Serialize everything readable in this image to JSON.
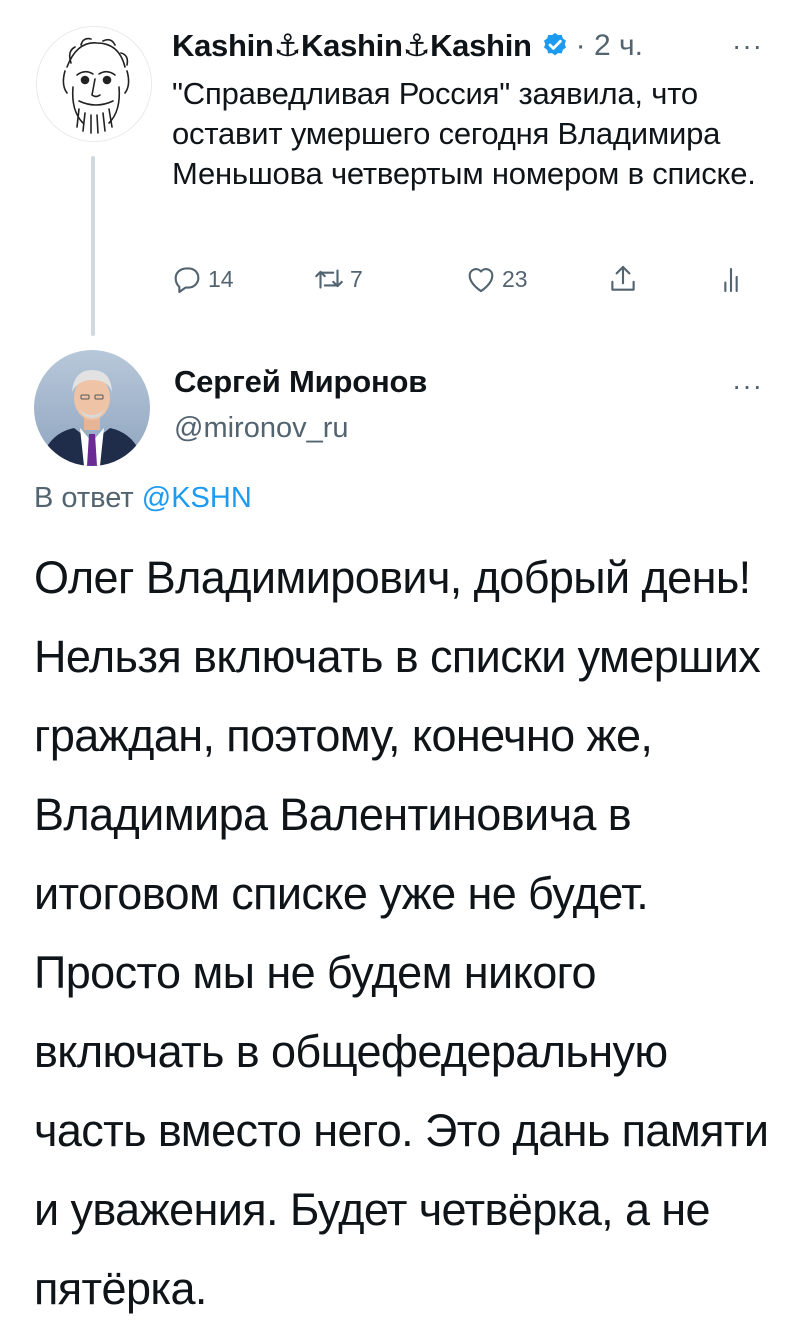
{
  "tweet1": {
    "display_name": "Kashin⚓Kashin⚓Kashin",
    "time": "· 2 ч.",
    "more": "···",
    "text": "\"Справедливая Россия\" заявила, что оставит умершего сегодня Владимира Меньшова четвертым номером в списке.",
    "actions": {
      "reply_count": "14",
      "retweet_count": "7",
      "like_count": "23"
    }
  },
  "tweet2": {
    "display_name": "Сергей Миронов",
    "handle": "@mironov_ru",
    "more": "···",
    "reply_prefix": "В ответ",
    "reply_to": "@KSHN",
    "text": "Олег Владимирович, добрый день! Нельзя включать в списки умерших граждан, поэтому, конечно же, Владимира Валентиновича в итоговом списке уже не будет. Просто мы не будем никого включать в общефедеральную часть вместо него. Это дань памяти и уважения. Будет четвёрка, а не пятёрка."
  },
  "colors": {
    "accent": "#1d9bf0",
    "muted": "#536471",
    "text": "#0f1419",
    "thread_line": "#cfd9de"
  },
  "icons": [
    "reply-icon",
    "retweet-icon",
    "like-icon",
    "share-icon",
    "analytics-icon",
    "verified-badge-icon",
    "more-icon"
  ]
}
